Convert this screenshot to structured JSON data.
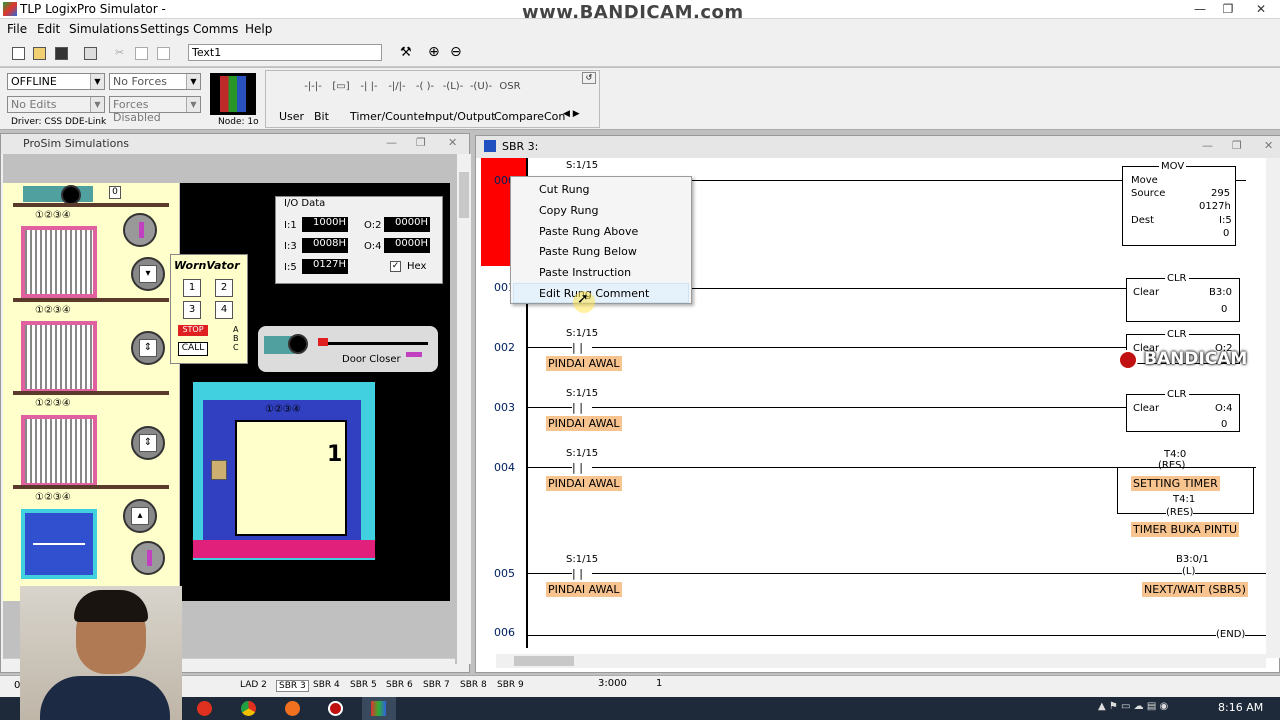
{
  "app": {
    "title": "TLP LogixPro Simulator  -",
    "watermark": "www.BANDICAM.com",
    "watermark2": "BANDICAM"
  },
  "menu": [
    "File",
    "Edit",
    "Simulations",
    "Settings",
    "Comms",
    "Help"
  ],
  "toolbar": {
    "text_value": "Text1"
  },
  "status": {
    "mode": "OFFLINE",
    "forces": "No Forces",
    "edits": "No Edits",
    "forces_state": "Forces Disabled",
    "driver": "Driver: CSS DDE-Link",
    "node": "Node: 1o",
    "instr_tabs": [
      "User",
      "Bit",
      "Timer/Counter",
      "Input/Output",
      "Compare",
      "Con"
    ],
    "osr": "OSR"
  },
  "prosim": {
    "title": "ProSim Simulations",
    "io_title": "I/O Data",
    "io": [
      {
        "label": "I:1",
        "value": "1000H",
        "label2": "O:2",
        "value2": "0000H"
      },
      {
        "label": "I:3",
        "value": "0008H",
        "label2": "O:4",
        "value2": "0000H"
      },
      {
        "label": "I:5",
        "value": "0127H"
      }
    ],
    "hex_label": "Hex",
    "brand": "WornVator",
    "keypad": [
      "1",
      "2",
      "3",
      "4"
    ],
    "stop": "STOP",
    "call": "CALL",
    "abc": "A B C",
    "door_closer": "Door Closer",
    "floor_display": "1",
    "floor_numbers": "①②③④",
    "top_counter": "0"
  },
  "ladder": {
    "title": "SBR 3:",
    "rungs": [
      {
        "no": "000",
        "contact_addr": "S:1/15"
      },
      {
        "no": "001",
        "contact_addr": ""
      },
      {
        "no": "002",
        "contact_addr": "S:1/15",
        "comment": "PINDAI AWAL"
      },
      {
        "no": "003",
        "contact_addr": "S:1/15",
        "comment": "PINDAI AWAL"
      },
      {
        "no": "004",
        "contact_addr": "S:1/15",
        "comment": "PINDAI AWAL"
      },
      {
        "no": "005",
        "contact_addr": "S:1/15",
        "comment": "PINDAI AWAL"
      },
      {
        "no": "006"
      }
    ],
    "mov": {
      "title": "MOV",
      "name": "Move",
      "source_lbl": "Source",
      "source_val": "295",
      "source_hex": "0127h",
      "dest_lbl": "Dest",
      "dest_addr": "I:5",
      "dest_val": "0"
    },
    "clr1": {
      "title": "CLR",
      "name": "Clear",
      "addr": "B3:0",
      "val": "0"
    },
    "clr2": {
      "title": "CLR",
      "name": "Clear",
      "addr": "O:2",
      "val": "0"
    },
    "clr3": {
      "title": "CLR",
      "name": "Clear",
      "addr": "O:4",
      "val": "0"
    },
    "res1": {
      "addr": "T4:0",
      "sym": "RES",
      "comment": "SETTING TIMER"
    },
    "res2": {
      "addr": "T4:1",
      "sym": "RES",
      "comment": "TIMER BUKA PINTU"
    },
    "latch": {
      "addr": "B3:0/1",
      "sym": "L",
      "comment": "NEXT/WAIT (SBR5)"
    },
    "end": "END"
  },
  "context_menu": [
    "Cut Rung",
    "Copy Rung",
    "Paste Rung Above",
    "Paste Rung Below",
    "Paste Instruction",
    "Edit Rung Comment"
  ],
  "statusbar": {
    "left": "0",
    "tabs": [
      "LAD 2",
      "SBR 3",
      "SBR 4",
      "SBR 5",
      "SBR 6",
      "SBR 7",
      "SBR 8",
      "SBR 9"
    ],
    "time": "3:000",
    "page": "1"
  },
  "taskbar": {
    "clock": "8:16 AM"
  }
}
